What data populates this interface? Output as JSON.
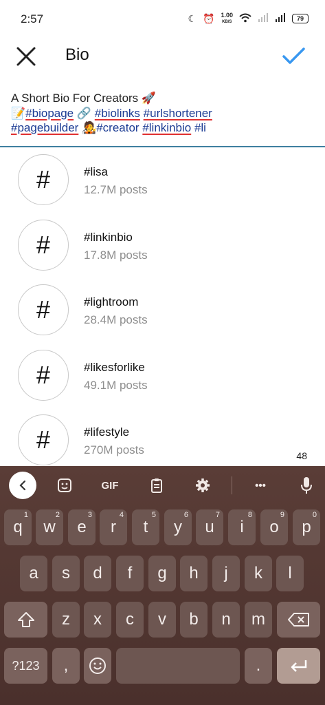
{
  "status_bar": {
    "time": "2:57",
    "net_speed": "1.00",
    "net_unit": "KB/S",
    "battery": "79"
  },
  "header": {
    "title": "Bio"
  },
  "bio": {
    "line1": "A Short Bio For Creators 🚀",
    "pencil": "📝",
    "tag_biopage": "#biopage",
    "link_emoji": "🔗",
    "tag_biolinks": "#biolinks",
    "tag_urlshortener": "#urlshortener",
    "tag_pagebuilder": "#pagebuilder",
    "person_emoji": "🧑‍🎤",
    "tag_creator": "#creator",
    "tag_linkinbio": "#linkinbio",
    "tag_partial": "#li"
  },
  "suggestions": [
    {
      "symbol": "#",
      "tag": "#lisa",
      "count": "12.7M posts"
    },
    {
      "symbol": "#",
      "tag": "#linkinbio",
      "count": "17.8M posts"
    },
    {
      "symbol": "#",
      "tag": "#lightroom",
      "count": "28.4M posts"
    },
    {
      "symbol": "#",
      "tag": "#likesforlike",
      "count": "49.1M posts"
    },
    {
      "symbol": "#",
      "tag": "#lifestyle",
      "count": "270M posts"
    }
  ],
  "char_count": "48",
  "keyboard": {
    "gif_label": "GIF",
    "more_label": "•••",
    "row1": [
      "q",
      "w",
      "e",
      "r",
      "t",
      "y",
      "u",
      "i",
      "o",
      "p"
    ],
    "row1_hints": [
      "1",
      "2",
      "3",
      "4",
      "5",
      "6",
      "7",
      "8",
      "9",
      "0"
    ],
    "row2": [
      "a",
      "s",
      "d",
      "f",
      "g",
      "h",
      "j",
      "k",
      "l"
    ],
    "row3": [
      "z",
      "x",
      "c",
      "v",
      "b",
      "n",
      "m"
    ],
    "symbols_label": "?123",
    "comma": ",",
    "period": "."
  }
}
